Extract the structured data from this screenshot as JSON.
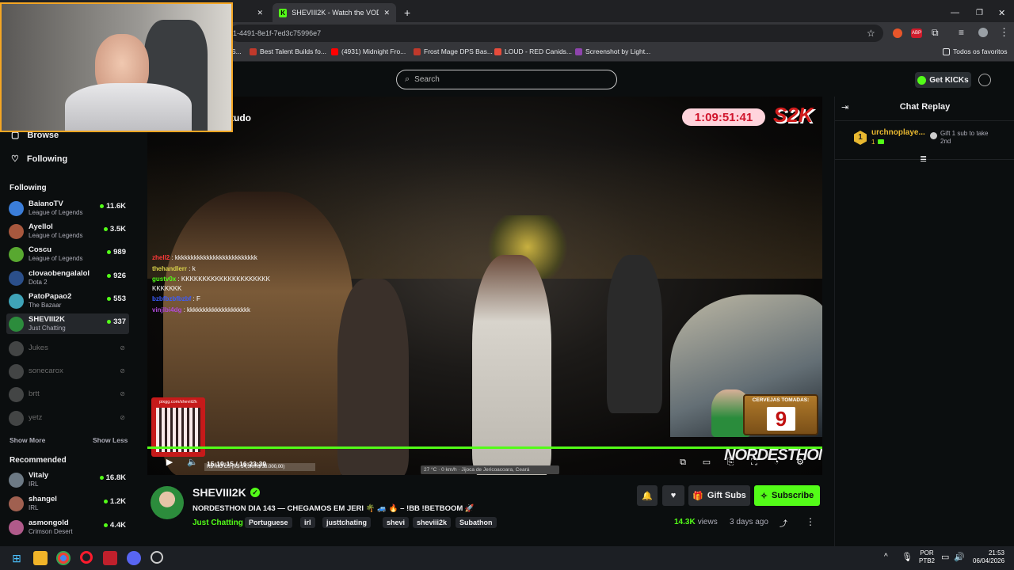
{
  "browser": {
    "tabs": [
      {
        "title": "SHEVIII2K - Watch the VOD on"
      }
    ],
    "url_fragment": "1-4491-8e1f-7ed3c75996e7",
    "bookmarks": [
      {
        "label": "S...",
        "color": "#e8a317"
      },
      {
        "label": "Best Talent Builds fo...",
        "color": "#c0392b"
      },
      {
        "label": "(4931) Midnight Fro...",
        "color": "#ff0000"
      },
      {
        "label": "Frost Mage DPS Bas...",
        "color": "#c0392b"
      },
      {
        "label": "LOUD - RED Canids...",
        "color": "#e74c3c"
      },
      {
        "label": "Screenshot by Light...",
        "color": "#8e44ad"
      }
    ],
    "all_bookmarks": "Todos os favoritos"
  },
  "header": {
    "search_placeholder": "Search",
    "get_kicks": "Get KICKs"
  },
  "sidebar": {
    "browse": "Browse",
    "following_nav": "Following",
    "following_heading": "Following",
    "following": [
      {
        "name": "BaianoTV",
        "game": "League of Legends",
        "viewers": "11.6K",
        "color": "#3b7dd8"
      },
      {
        "name": "Ayellol",
        "game": "League of Legends",
        "viewers": "3.5K",
        "color": "#a8583e"
      },
      {
        "name": "Coscu",
        "game": "League of Legends",
        "viewers": "989",
        "color": "#58a830"
      },
      {
        "name": "clovaobengalalol",
        "game": "Dota 2",
        "viewers": "926",
        "color": "#2b4f8a"
      },
      {
        "name": "PatoPapao2",
        "game": "The Bazaar",
        "viewers": "553",
        "color": "#3fa3b8"
      },
      {
        "name": "SHEVIII2K",
        "game": "Just Chatting",
        "viewers": "337",
        "color": "#2c8c3c"
      }
    ],
    "offline": [
      {
        "name": "Jukes"
      },
      {
        "name": "sonecarox"
      },
      {
        "name": "brtt"
      },
      {
        "name": "yetz"
      }
    ],
    "show_more": "Show More",
    "show_less": "Show Less",
    "recommended_heading": "Recommended",
    "recommended": [
      {
        "name": "Vitaly",
        "game": "IRL",
        "viewers": "16.8K",
        "color": "#6d7a85"
      },
      {
        "name": "shangel",
        "game": "IRL",
        "viewers": "1.2K",
        "color": "#a06050"
      },
      {
        "name": "asmongold",
        "game": "Crimson Desert",
        "viewers": "4.4K",
        "color": "#b05a8a"
      }
    ]
  },
  "video": {
    "timer": "1:09:51:41",
    "logo": "S2K",
    "overlay_title": "tudo",
    "chat": [
      {
        "user": "zhell2",
        "color": "#ff3a3a",
        "msg": "kkkkkkkkkkkkkkkkkkkkkkkkkk"
      },
      {
        "user": "thehandlerr",
        "color": "#d8d24a",
        "msg": "k"
      },
      {
        "user": "gustv0x",
        "color": "#53fc18",
        "msg": "KKKKKKKKKKKKKKKKKKKKKKKKKKKK"
      },
      {
        "user": "bzbfbzbfbzbf",
        "color": "#3a5cff",
        "msg": "F"
      },
      {
        "user": "vinjlbi4dg",
        "color": "#b04ad8",
        "msg": "kkkkkkkkkkkkkkkkkkkk"
      }
    ],
    "qr_label": "pixgg.com/sheviii2k",
    "beer_title": "CERVEJAS TOMADAS:",
    "beer_count": "9",
    "nordesthon": "NORDESTHON",
    "timecode": "15:19:15 / 16:23:39",
    "goal_text": "R$ RIO CS (R$ 14,5K/R$ 38.000,00)",
    "status_bar": "27 °C  ·  0 km/h  ·  Jijoca de Jericoacoara, Ceará"
  },
  "chat_panel": {
    "title": "Chat Replay",
    "gift_rank": "1",
    "gift_user": "urchnoplaye...",
    "gift_count": "1",
    "gift_text": "Gift 1 sub to take 2nd"
  },
  "stream_info": {
    "channel": "SHEVIII2K",
    "title": "NORDESTHON DIA 143 — CHEGAMOS EM JERI 🌴 🚙 🔥 – !BB !BETBOOM 🚀",
    "category": "Just Chatting",
    "tags": [
      "Portuguese",
      "irl",
      "justtchating",
      "shevi",
      "sheviii2k",
      "Subathon"
    ],
    "views": "14.3K",
    "views_label": "views",
    "age": "3 days ago",
    "gift_subs": "Gift Subs",
    "subscribe": "Subscribe"
  },
  "taskbar": {
    "lang1": "POR",
    "lang2": "PTB2",
    "time": "21:53",
    "date": "06/04/2026"
  },
  "colors": {
    "accent": "#53fc18",
    "timer_text": "#d0142c",
    "webcam_border": "#f5a623"
  }
}
